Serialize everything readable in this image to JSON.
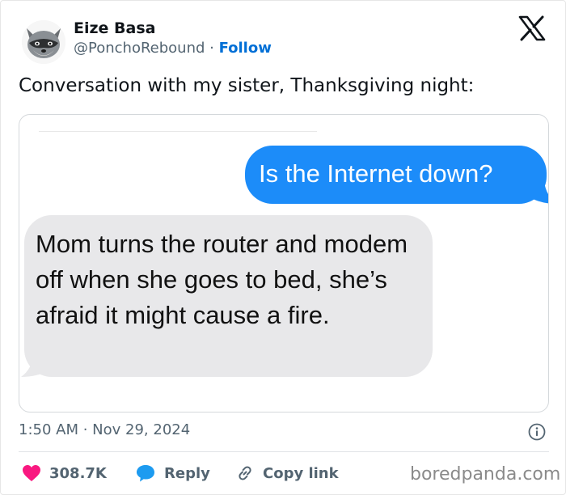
{
  "author": {
    "name": "Eize Basa",
    "handle": "@PonchoRebound",
    "separator": " · ",
    "follow_label": "Follow"
  },
  "platform_icon": "x-logo-icon",
  "tweet": {
    "text": "Conversation with my sister, Thanksgiving night:"
  },
  "media": {
    "outgoing_message": "Is the Internet down?",
    "incoming_message": "Mom turns the router and modem off when she goes to bed, she’s afraid it might cause a fire.",
    "outgoing_color": "#1c8cf9",
    "incoming_color": "#e8e8ea"
  },
  "meta": {
    "time": "1:50 AM",
    "separator": " · ",
    "date": "Nov 29, 2024"
  },
  "actions": {
    "likes": "308.7K",
    "reply_label": "Reply",
    "copy_label": "Copy link"
  },
  "colors": {
    "like": "#f91880",
    "reply": "#1d9bf0",
    "follow": "#006fd6",
    "muted": "#536471"
  },
  "watermark": "boredpanda.com"
}
